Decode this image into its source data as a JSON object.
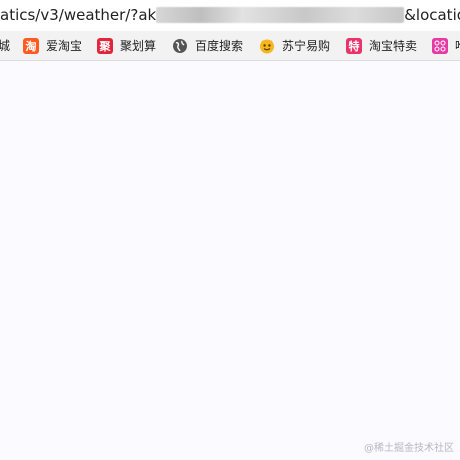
{
  "address_bar": {
    "url_visible_start": "atics/v3/weather/?ak",
    "url_visible_end": "&location"
  },
  "bookmarks": [
    {
      "label": "城",
      "icon": "truncated-bookmark",
      "color": "#cccccc"
    },
    {
      "label": "爱淘宝",
      "icon": "taobao-icon",
      "glyph": "淘",
      "color": "#ff5a1f"
    },
    {
      "label": "聚划算",
      "icon": "juhuasuan-icon",
      "glyph": "聚",
      "color": "#e0263b"
    },
    {
      "label": "百度搜索",
      "icon": "globe-icon",
      "glyph": "",
      "color": "#555555"
    },
    {
      "label": "苏宁易购",
      "icon": "suning-icon",
      "glyph": "",
      "color": "#f7b71c"
    },
    {
      "label": "淘宝特卖",
      "icon": "taobao-temai-icon",
      "glyph": "特",
      "color": "#e8336b"
    },
    {
      "label": "唯",
      "icon": "vip-icon",
      "glyph": "",
      "color": "#e43ba4"
    }
  ],
  "watermark": "@稀土掘金技术社区"
}
